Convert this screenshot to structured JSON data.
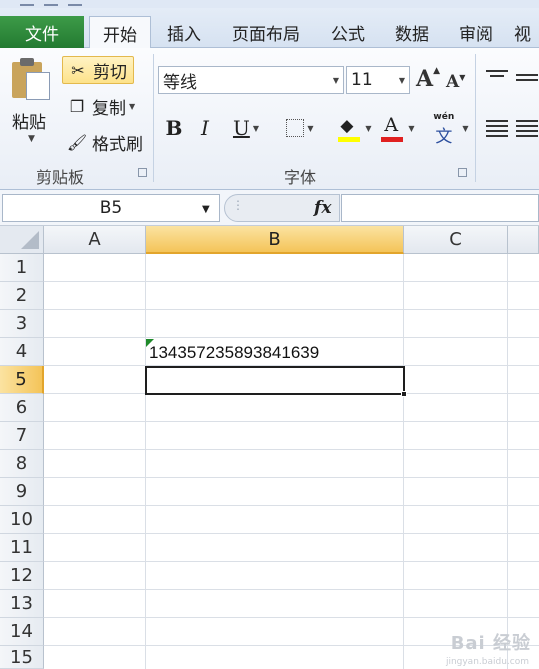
{
  "tabs": {
    "file": "文件",
    "home": "开始",
    "insert": "插入",
    "page_layout": "页面布局",
    "formulas": "公式",
    "data": "数据",
    "review": "审阅",
    "view": "视"
  },
  "clipboard": {
    "paste_label": "粘贴",
    "cut_label": "剪切",
    "copy_label": "复制",
    "format_painter_label": "格式刷",
    "group_label": "剪贴板"
  },
  "font": {
    "font_name": "等线",
    "font_size": "11",
    "bold": "B",
    "italic": "I",
    "underline": "U",
    "grow": "A",
    "shrink": "A",
    "font_color": "A",
    "phonetic": "wén",
    "phonetic_char": "文",
    "group_label": "字体",
    "fill_color": "#ffff00",
    "font_color_value": "#e02020"
  },
  "formula_bar": {
    "name_box": "B5",
    "fx": "fx",
    "formula": ""
  },
  "grid": {
    "columns": [
      "A",
      "B",
      "C"
    ],
    "selected_column": "B",
    "rows": [
      "1",
      "2",
      "3",
      "4",
      "5",
      "6",
      "7",
      "8",
      "9",
      "10",
      "11",
      "12",
      "13",
      "14",
      "15"
    ],
    "selected_row": "5",
    "cells": {
      "B4": "134357235893841639"
    },
    "active_cell": "B5"
  },
  "watermark": {
    "main": "Bai 经验",
    "sub": "jingyan.baidu.com"
  },
  "colors": {
    "file_tab": "#2e8b3c",
    "selection_header": "#f4c459",
    "error_indicator": "#1f8a2a"
  }
}
